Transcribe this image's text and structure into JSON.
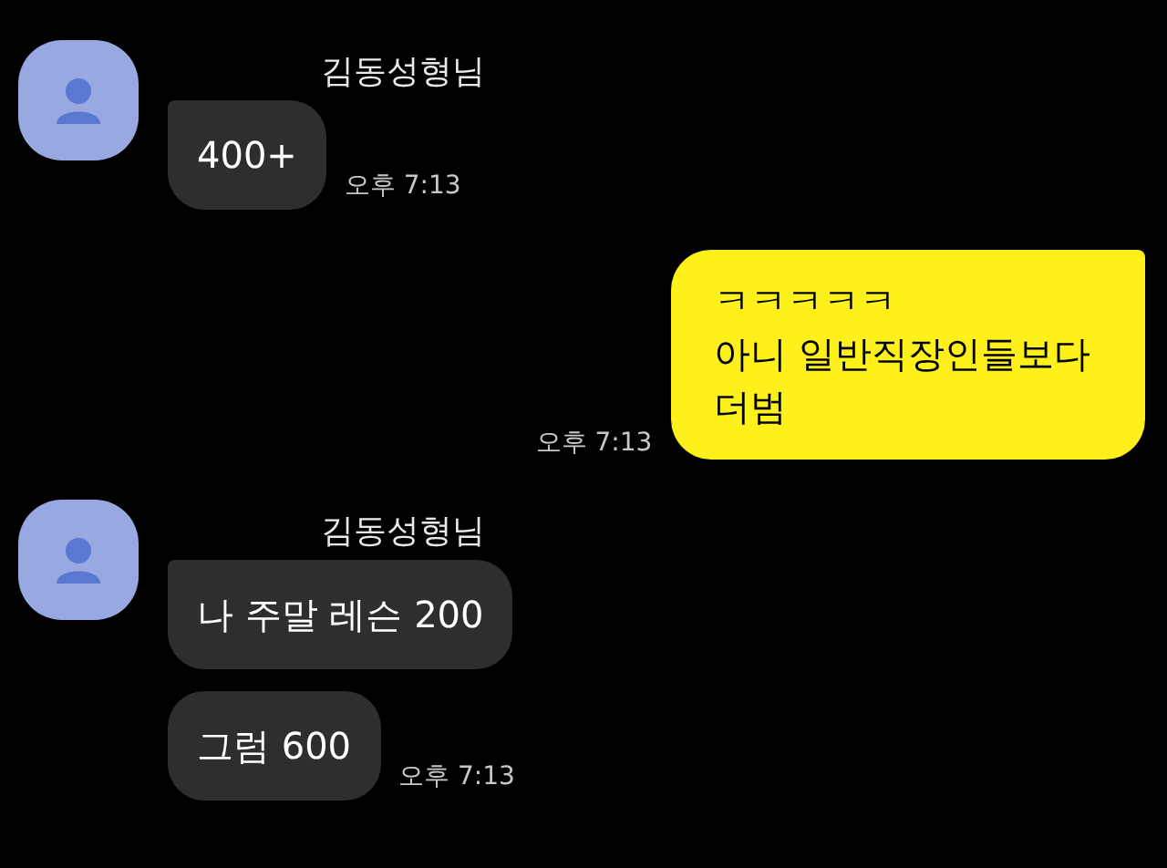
{
  "messages": [
    {
      "kind": "incoming",
      "sender": "김동성형님",
      "bubbles": [
        "400+"
      ],
      "time": "오후 7:13"
    },
    {
      "kind": "outgoing",
      "bubbles": [
        "ㅋㅋㅋㅋㅋ\n아니 일반직장인들보다\n더범"
      ],
      "time": "오후 7:13"
    },
    {
      "kind": "incoming",
      "sender": "김동성형님",
      "bubbles": [
        "나 주말 레슨 200",
        "그럼 600"
      ],
      "time": "오후 7:13"
    }
  ]
}
